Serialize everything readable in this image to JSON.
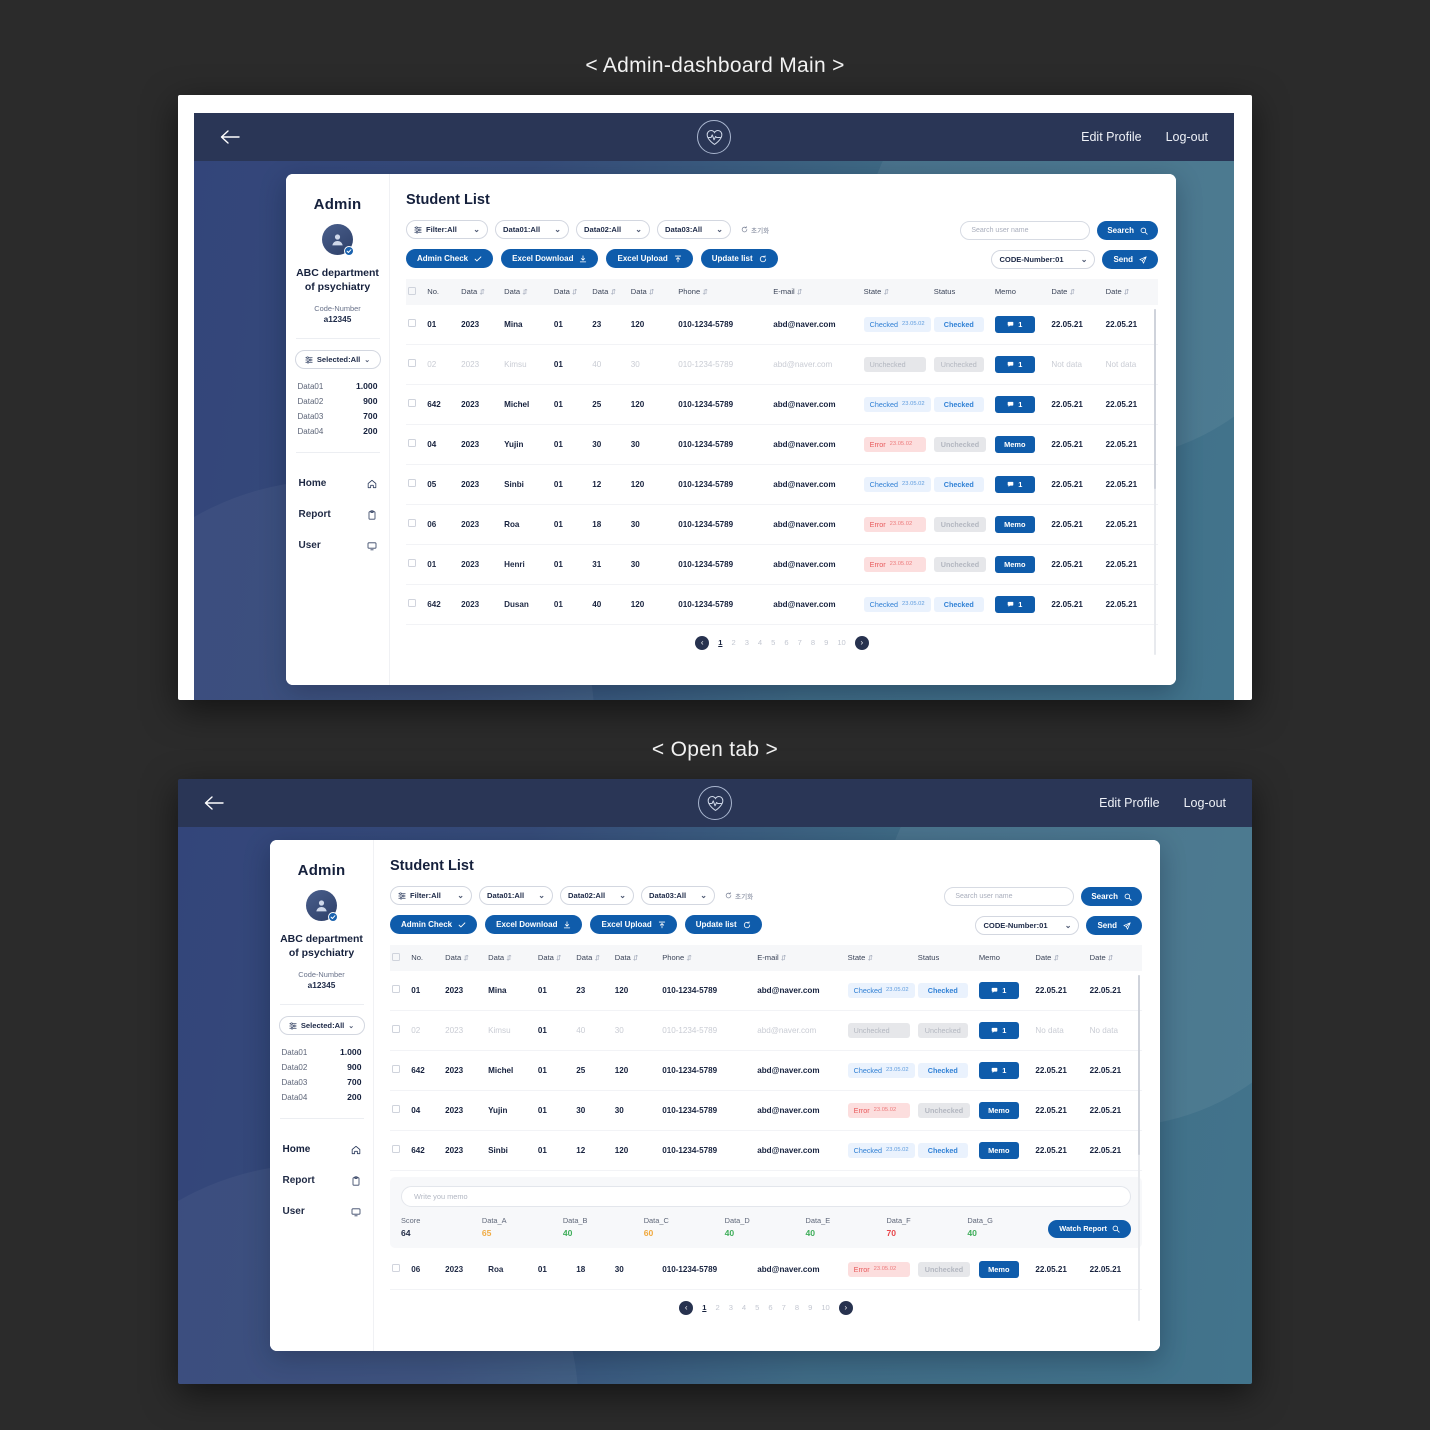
{
  "captions": {
    "main": "< Admin-dashboard Main >",
    "open": "< Open tab >"
  },
  "topbar": {
    "back_icon": "arrow-left-icon",
    "logo_icon": "heartbeat-logo-icon",
    "edit_profile": "Edit Profile",
    "logout": "Log-out"
  },
  "sidebar": {
    "title": "Admin",
    "avatar_icon": "user-avatar-icon",
    "department": "ABC department\nof psychiatry",
    "department_line1": "ABC department",
    "department_line2": "of psychiatry",
    "code_label": "Code-Number",
    "code_value": "a12345",
    "selected": "Selected:All",
    "stats": [
      {
        "label": "Data01",
        "value": "1.000"
      },
      {
        "label": "Data02",
        "value": "900"
      },
      {
        "label": "Data03",
        "value": "700"
      },
      {
        "label": "Data04",
        "value": "200"
      }
    ],
    "nav": [
      {
        "label": "Home",
        "icon": "home-icon"
      },
      {
        "label": "Report",
        "icon": "clipboard-icon"
      },
      {
        "label": "User",
        "icon": "monitor-icon"
      }
    ]
  },
  "main": {
    "page_title": "Student List",
    "filters": [
      {
        "label": "Filter:All",
        "icon": "filter-icon"
      },
      {
        "label": "Data01:All"
      },
      {
        "label": "Data02:All"
      },
      {
        "label": "Data03:All"
      }
    ],
    "reset_label": "초기화",
    "reset_icon": "refresh-icon",
    "actions": [
      {
        "label": "Admin Check",
        "icon": "check-icon"
      },
      {
        "label": "Excel Download",
        "icon": "download-icon"
      },
      {
        "label": "Excel Upload",
        "icon": "upload-icon"
      },
      {
        "label": "Update list",
        "icon": "refresh-icon"
      }
    ],
    "search": {
      "placeholder": "Search user name",
      "button": "Search",
      "button_icon": "search-icon"
    },
    "code_select": "CODE-Number:01",
    "send": {
      "label": "Send",
      "icon": "send-icon"
    },
    "columns": [
      "No.",
      "Data",
      "Data",
      "Data",
      "Data",
      "Data",
      "Phone",
      "E-mail",
      "State",
      "Status",
      "Memo",
      "Date",
      "Date"
    ],
    "sortable_columns": [
      false,
      true,
      true,
      true,
      true,
      true,
      true,
      true,
      true,
      false,
      false,
      true,
      true
    ],
    "rows": [
      {
        "no": "01",
        "d1": "2023",
        "d2": "Mina",
        "d3": "01",
        "d4": "23",
        "d5": "120",
        "phone": "010-1234-5789",
        "email": "abd@naver.com",
        "state": "Checked",
        "state_ts": "23.05.02",
        "state_kind": "checked",
        "status": "Checked",
        "status_kind": "checked",
        "memo": "1",
        "memo_kind": "count",
        "date1": "22.05.21",
        "date2": "22.05.21",
        "dim": false
      },
      {
        "no": "02",
        "d1": "2023",
        "d2": "Kimsu",
        "d3": "01",
        "d4": "40",
        "d5": "30",
        "phone": "010-1234-5789",
        "email": "abd@naver.com",
        "state": "Unchecked",
        "state_ts": "",
        "state_kind": "unchk",
        "status": "Unchecked",
        "status_kind": "unchk",
        "memo": "1",
        "memo_kind": "count",
        "date1": "Not data",
        "date2": "Not data",
        "dim": true
      },
      {
        "no": "642",
        "d1": "2023",
        "d2": "Michel",
        "d3": "01",
        "d4": "25",
        "d5": "120",
        "phone": "010-1234-5789",
        "email": "abd@naver.com",
        "state": "Checked",
        "state_ts": "23.05.02",
        "state_kind": "checked",
        "status": "Checked",
        "status_kind": "checked",
        "memo": "1",
        "memo_kind": "count",
        "date1": "22.05.21",
        "date2": "22.05.21",
        "dim": false
      },
      {
        "no": "04",
        "d1": "2023",
        "d2": "Yujin",
        "d3": "01",
        "d4": "30",
        "d5": "30",
        "phone": "010-1234-5789",
        "email": "abd@naver.com",
        "state": "Error",
        "state_ts": "23.05.02",
        "state_kind": "error",
        "status": "Unchecked",
        "status_kind": "unchk",
        "memo": "Memo",
        "memo_kind": "text",
        "date1": "22.05.21",
        "date2": "22.05.21",
        "dim": false
      },
      {
        "no": "05",
        "d1": "2023",
        "d2": "Sinbi",
        "d3": "01",
        "d4": "12",
        "d5": "120",
        "phone": "010-1234-5789",
        "email": "abd@naver.com",
        "state": "Checked",
        "state_ts": "23.05.02",
        "state_kind": "checked",
        "status": "Checked",
        "status_kind": "checked",
        "memo": "1",
        "memo_kind": "count",
        "date1": "22.05.21",
        "date2": "22.05.21",
        "dim": false
      },
      {
        "no": "06",
        "d1": "2023",
        "d2": "Roa",
        "d3": "01",
        "d4": "18",
        "d5": "30",
        "phone": "010-1234-5789",
        "email": "abd@naver.com",
        "state": "Error",
        "state_ts": "23.05.02",
        "state_kind": "error",
        "status": "Unchecked",
        "status_kind": "unchk",
        "memo": "Memo",
        "memo_kind": "text",
        "date1": "22.05.21",
        "date2": "22.05.21",
        "dim": false
      },
      {
        "no": "01",
        "d1": "2023",
        "d2": "Henri",
        "d3": "01",
        "d4": "31",
        "d5": "30",
        "phone": "010-1234-5789",
        "email": "abd@naver.com",
        "state": "Error",
        "state_ts": "23.05.02",
        "state_kind": "error",
        "status": "Unchecked",
        "status_kind": "unchk",
        "memo": "Memo",
        "memo_kind": "text",
        "date1": "22.05.21",
        "date2": "22.05.21",
        "dim": false
      },
      {
        "no": "642",
        "d1": "2023",
        "d2": "Dusan",
        "d3": "01",
        "d4": "40",
        "d5": "120",
        "phone": "010-1234-5789",
        "email": "abd@naver.com",
        "state": "Checked",
        "state_ts": "23.05.02",
        "state_kind": "checked",
        "status": "Checked",
        "status_kind": "checked",
        "memo": "1",
        "memo_kind": "count",
        "date1": "22.05.21",
        "date2": "22.05.21",
        "dim": false
      }
    ],
    "pagination": {
      "prev_icon": "chevron-left-icon",
      "next_icon": "chevron-right-icon",
      "pages": [
        "1",
        "2",
        "3",
        "4",
        "5",
        "6",
        "7",
        "8",
        "9",
        "10"
      ],
      "active": "1"
    }
  },
  "open_tab": {
    "rows": [
      {
        "no": "01",
        "d1": "2023",
        "d2": "Mina",
        "d3": "01",
        "d4": "23",
        "d5": "120",
        "phone": "010-1234-5789",
        "email": "abd@naver.com",
        "state": "Checked",
        "state_ts": "23.05.02",
        "state_kind": "checked",
        "status": "Checked",
        "status_kind": "checked",
        "memo": "1",
        "memo_kind": "count",
        "date1": "22.05.21",
        "date2": "22.05.21",
        "dim": false
      },
      {
        "no": "02",
        "d1": "2023",
        "d2": "Kimsu",
        "d3": "01",
        "d4": "40",
        "d5": "30",
        "phone": "010-1234-5789",
        "email": "abd@naver.com",
        "state": "Unchecked",
        "state_ts": "",
        "state_kind": "unchk",
        "status": "Unchecked",
        "status_kind": "unchk",
        "memo": "1",
        "memo_kind": "count",
        "date1": "No data",
        "date2": "No data",
        "dim": true
      },
      {
        "no": "642",
        "d1": "2023",
        "d2": "Michel",
        "d3": "01",
        "d4": "25",
        "d5": "120",
        "phone": "010-1234-5789",
        "email": "abd@naver.com",
        "state": "Checked",
        "state_ts": "23.05.02",
        "state_kind": "checked",
        "status": "Checked",
        "status_kind": "checked",
        "memo": "1",
        "memo_kind": "count",
        "date1": "22.05.21",
        "date2": "22.05.21",
        "dim": false
      },
      {
        "no": "04",
        "d1": "2023",
        "d2": "Yujin",
        "d3": "01",
        "d4": "30",
        "d5": "30",
        "phone": "010-1234-5789",
        "email": "abd@naver.com",
        "state": "Error",
        "state_ts": "23.05.02",
        "state_kind": "error",
        "status": "Unchecked",
        "status_kind": "unchk",
        "memo": "Memo",
        "memo_kind": "text",
        "date1": "22.05.21",
        "date2": "22.05.21",
        "dim": false
      },
      {
        "no": "642",
        "d1": "2023",
        "d2": "Sinbi",
        "d3": "01",
        "d4": "12",
        "d5": "120",
        "phone": "010-1234-5789",
        "email": "abd@naver.com",
        "state": "Checked",
        "state_ts": "23.05.02",
        "state_kind": "checked",
        "status": "Checked",
        "status_kind": "checked",
        "memo": "Memo",
        "memo_kind": "text",
        "date1": "22.05.21",
        "date2": "22.05.21",
        "dim": false
      }
    ],
    "memo_panel": {
      "placeholder": "Write you memo",
      "send_icon": "arrow-up-circle-icon",
      "scores": [
        {
          "label": "Score",
          "value": "64",
          "color": "#16213d"
        },
        {
          "label": "Data_A",
          "value": "65",
          "color": "#f0a83c"
        },
        {
          "label": "Data_B",
          "value": "40",
          "color": "#3fae5a"
        },
        {
          "label": "Data_C",
          "value": "60",
          "color": "#f0a83c"
        },
        {
          "label": "Data_D",
          "value": "40",
          "color": "#3fae5a"
        },
        {
          "label": "Data_E",
          "value": "40",
          "color": "#3fae5a"
        },
        {
          "label": "Data_F",
          "value": "70",
          "color": "#e8464a"
        },
        {
          "label": "Data_G",
          "value": "40",
          "color": "#3fae5a"
        }
      ],
      "watch_report": "Watch Report",
      "watch_icon": "search-icon"
    },
    "last_row": {
      "no": "06",
      "d1": "2023",
      "d2": "Roa",
      "d3": "01",
      "d4": "18",
      "d5": "30",
      "phone": "010-1234-5789",
      "email": "abd@naver.com",
      "state": "Error",
      "state_ts": "23.05.02",
      "state_kind": "error",
      "status": "Unchecked",
      "status_kind": "unchk",
      "memo": "Memo",
      "memo_kind": "text",
      "date1": "22.05.21",
      "date2": "22.05.21",
      "dim": false
    }
  },
  "colors": {
    "brand_blue": "#0f5cab",
    "navy": "#2a3656",
    "teal": "#42748c"
  }
}
